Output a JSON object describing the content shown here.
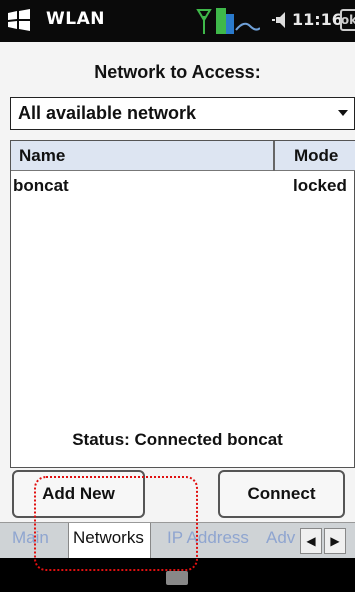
{
  "titlebar": {
    "title": "WLAN",
    "clock": "11:16",
    "close_label": "ok",
    "icons": [
      "windows-start-icon",
      "signal-antenna-icon",
      "connectivity-icon",
      "speaker-icon",
      "ok-close-icon"
    ]
  },
  "main": {
    "section_label": "Network to Access:",
    "dropdown_value": "All available network",
    "list": {
      "columns": [
        "Name",
        "Mode"
      ],
      "rows": [
        {
          "name": "boncat",
          "mode": "locked"
        }
      ]
    },
    "status": "Status: Connected boncat",
    "buttons": {
      "add_new": "Add New",
      "connect": "Connect"
    }
  },
  "tabs": {
    "items": [
      "Main",
      "Networks",
      "IP Address",
      "Advanced"
    ],
    "active": "Networks",
    "scroll_left": "◀",
    "scroll_right": "▶"
  },
  "colors": {
    "highlight": "#e01010",
    "tab_inactive": "#8fa5d0",
    "header_bg": "#dde5f2"
  }
}
